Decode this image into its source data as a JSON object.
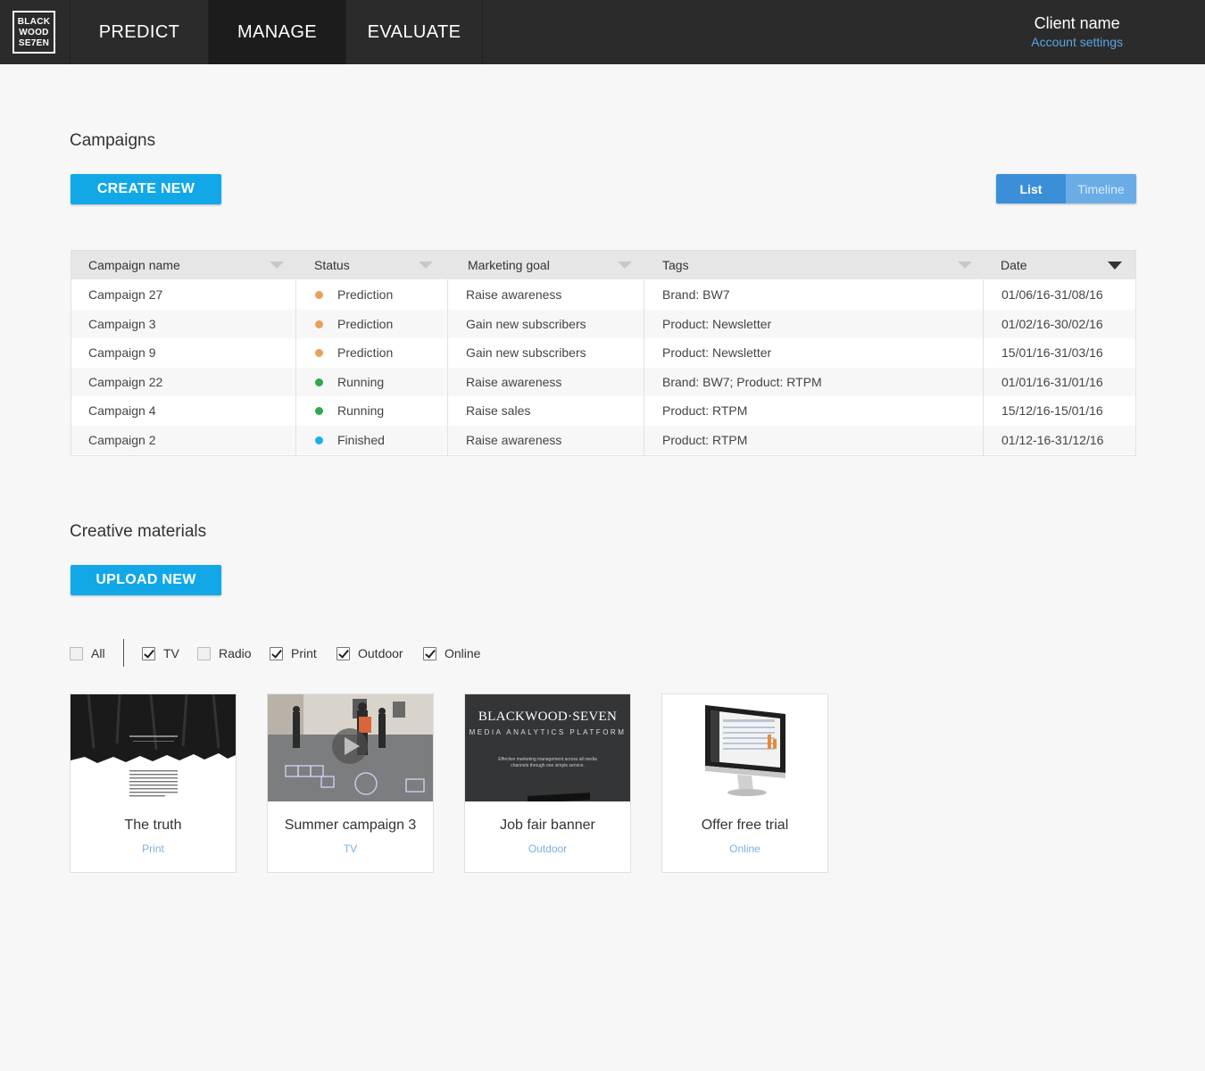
{
  "header": {
    "logo_lines": [
      "BLACK",
      "WOOD",
      "SE7EN"
    ],
    "nav": [
      {
        "label": "PREDICT",
        "active": false
      },
      {
        "label": "MANAGE",
        "active": true
      },
      {
        "label": "EVALUATE",
        "active": false
      }
    ],
    "client_name": "Client name",
    "account_settings": "Account settings"
  },
  "campaigns": {
    "title": "Campaigns",
    "create_button": "CREATE NEW",
    "view_toggle": {
      "list": "List",
      "timeline": "Timeline",
      "selected": "List"
    },
    "columns": [
      "Campaign name",
      "Status",
      "Marketing goal",
      "Tags",
      "Date"
    ],
    "sorted_column": "Date",
    "status_colors": {
      "Prediction": "#e8a05a",
      "Running": "#2fa84f",
      "Finished": "#1ab2e8"
    },
    "rows": [
      {
        "name": "Campaign 27",
        "status": "Prediction",
        "goal": "Raise awareness",
        "tags": "Brand: BW7",
        "date": "01/06/16-31/08/16"
      },
      {
        "name": "Campaign 3",
        "status": "Prediction",
        "goal": "Gain new subscribers",
        "tags": "Product: Newsletter",
        "date": "01/02/16-30/02/16"
      },
      {
        "name": "Campaign 9",
        "status": "Prediction",
        "goal": "Gain new subscribers",
        "tags": "Product: Newsletter",
        "date": "15/01/16-31/03/16"
      },
      {
        "name": "Campaign 22",
        "status": "Running",
        "goal": "Raise awareness",
        "tags": "Brand: BW7; Product: RTPM",
        "date": "01/01/16-31/01/16"
      },
      {
        "name": "Campaign 4",
        "status": "Running",
        "goal": "Raise sales",
        "tags": "Product: RTPM",
        "date": "15/12/16-15/01/16"
      },
      {
        "name": "Campaign 2",
        "status": "Finished",
        "goal": "Raise awareness",
        "tags": "Product: RTPM",
        "date": "01/12-16-31/12/16"
      }
    ]
  },
  "creative": {
    "title": "Creative materials",
    "upload_button": "UPLOAD NEW",
    "filters": [
      {
        "label": "All",
        "checked": false
      },
      {
        "label": "TV",
        "checked": true
      },
      {
        "label": "Radio",
        "checked": false
      },
      {
        "label": "Print",
        "checked": true
      },
      {
        "label": "Outdoor",
        "checked": true
      },
      {
        "label": "Online",
        "checked": true
      }
    ],
    "cards": [
      {
        "title": "The truth",
        "type": "Print",
        "thumb": "print-ad"
      },
      {
        "title": "Summer campaign 3",
        "type": "TV",
        "thumb": "video-still"
      },
      {
        "title": "Job fair banner",
        "type": "Outdoor",
        "thumb": "banner"
      },
      {
        "title": "Offer free trial",
        "type": "Online",
        "thumb": "monitor"
      }
    ],
    "banner_brand": "BLACKWOOD·SEVEN",
    "banner_subtitle": "MEDIA ANALYTICS PLATFORM",
    "banner_text": "Effective marketing management across all media channels through one simple service."
  }
}
